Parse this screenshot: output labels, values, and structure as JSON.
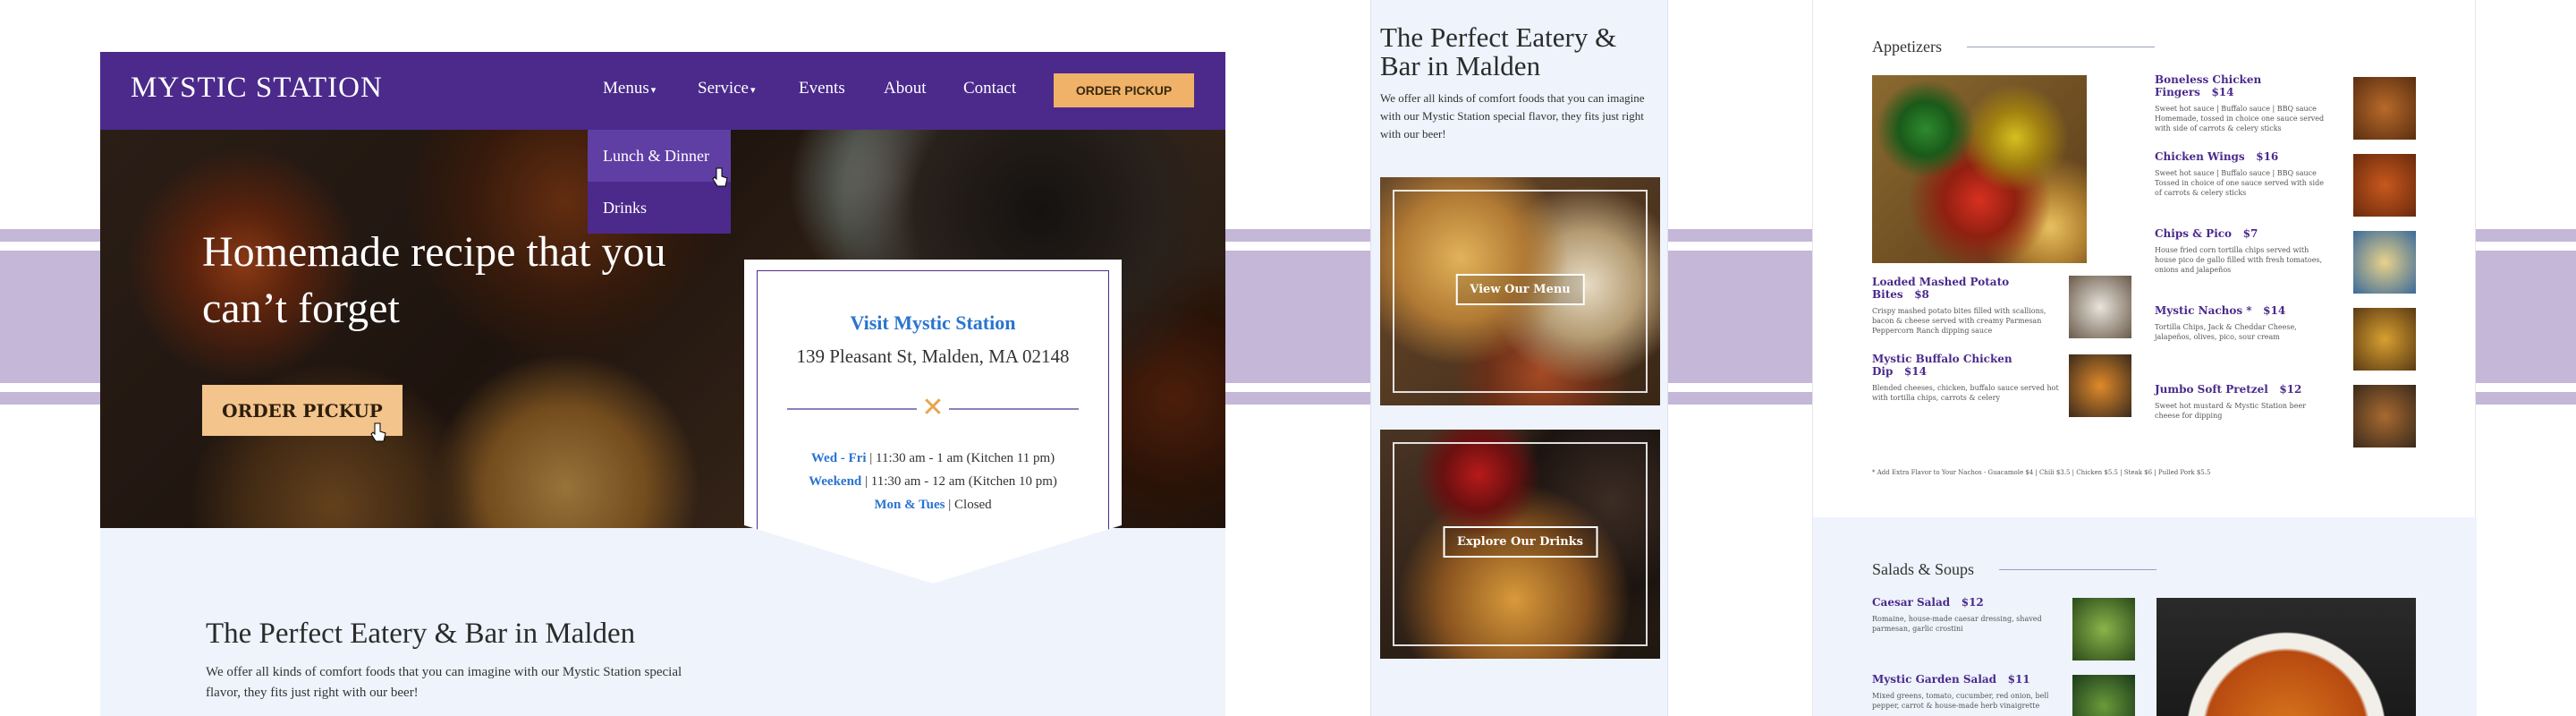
{
  "desktop": {
    "logo": "MYSTIC STATION",
    "nav": {
      "items": [
        {
          "label": "Menus",
          "has_caret": true
        },
        {
          "label": "Service",
          "has_caret": true
        },
        {
          "label": "Events"
        },
        {
          "label": "About"
        },
        {
          "label": "Contact"
        }
      ],
      "order_button": "ORDER PICKUP",
      "dropdown": [
        "Lunch & Dinner",
        "Drinks"
      ]
    },
    "hero": {
      "title": "Homemade recipe that you can’t forget",
      "button": "ORDER PICKUP"
    },
    "visit": {
      "title": "Visit Mystic Station",
      "address": "139 Pleasant St, Malden, MA 02148",
      "hours": [
        {
          "days": "Wed - Fri",
          "time": " | 11:30 am - 1 am (Kitchen 11 pm)"
        },
        {
          "days": "Weekend",
          "time": " | 11:30 am - 12 am (Kitchen 10 pm)"
        },
        {
          "days": "Mon & Tues",
          "time": " | Closed"
        }
      ]
    },
    "about": {
      "title": "The Perfect Eatery & Bar in Malden",
      "text": "We offer all kinds of comfort foods that you can imagine with our Mystic Station special flavor, they fits just right with our beer!"
    }
  },
  "mobile": {
    "title": "The Perfect Eatery & Bar in Malden",
    "text": "We offer all kinds of comfort foods that you can imagine with our Mystic Station special flavor, they fits just right with our beer!",
    "card1_button": "View Our Menu",
    "card2_button": "Explore Our Drinks"
  },
  "menu": {
    "appetizers_heading": "Appetizers",
    "appetizers": [
      {
        "name": "Boneless Chicken Fingers",
        "price": "$14",
        "desc": "Sweet hot sauce | Buffalo sauce | BBQ sauce Homemade, tossed in choice one sauce served with side of carrots & celery sticks"
      },
      {
        "name": "Chicken Wings",
        "price": "$16",
        "desc": "Sweet hot sauce | Buffalo sauce | BBQ sauce Tossed in choice of one sauce served with side of carrots & celery sticks"
      },
      {
        "name": "Chips & Pico",
        "price": "$7",
        "desc": "House fried corn tortilla chips served with house pico de gallo filled with fresh tomatoes, onions and jalapeños"
      },
      {
        "name": "Mystic Nachos *",
        "price": "$14",
        "desc": "Tortilla Chips, Jack & Cheddar Cheese, jalapeños, olives, pico, sour cream"
      },
      {
        "name": "Jumbo Soft Pretzel",
        "price": "$12",
        "desc": "Sweet hot mustard & Mystic Station beer cheese for dipping"
      },
      {
        "name": "Loaded Mashed Potato Bites",
        "price": "$8",
        "desc": "Crispy mashed potato bites filled with scallions, bacon & cheese served with creamy Parmesan Peppercorn Ranch dipping sauce"
      },
      {
        "name": "Mystic Buffalo Chicken Dip",
        "price": "$14",
        "desc": "Blended cheeses, chicken, buffalo sauce served hot with tortilla chips, carrots & celery"
      }
    ],
    "footnote": "* Add Extra Flavor to Your Nachos - Guacamole $4 | Chili $3.5 | Chicken $5.5 | Steak $6 | Pulled Pork $5.5",
    "salads_heading": "Salads & Soups",
    "salads": [
      {
        "name": "Caesar Salad",
        "price": "$12",
        "desc": "Romaine, house-made caesar dressing, shaved parmesan, garlic crostini"
      },
      {
        "name": "Mystic Garden Salad",
        "price": "$11",
        "desc": "Mixed greens, tomato, cucumber, red onion, bell pepper, carrot & house-made herb vinaigrette"
      }
    ]
  },
  "colors": {
    "brand": "#4b2a8c",
    "accent": "#f0b268",
    "link": "#2a74d0",
    "stripe": "#c5b7d8"
  }
}
